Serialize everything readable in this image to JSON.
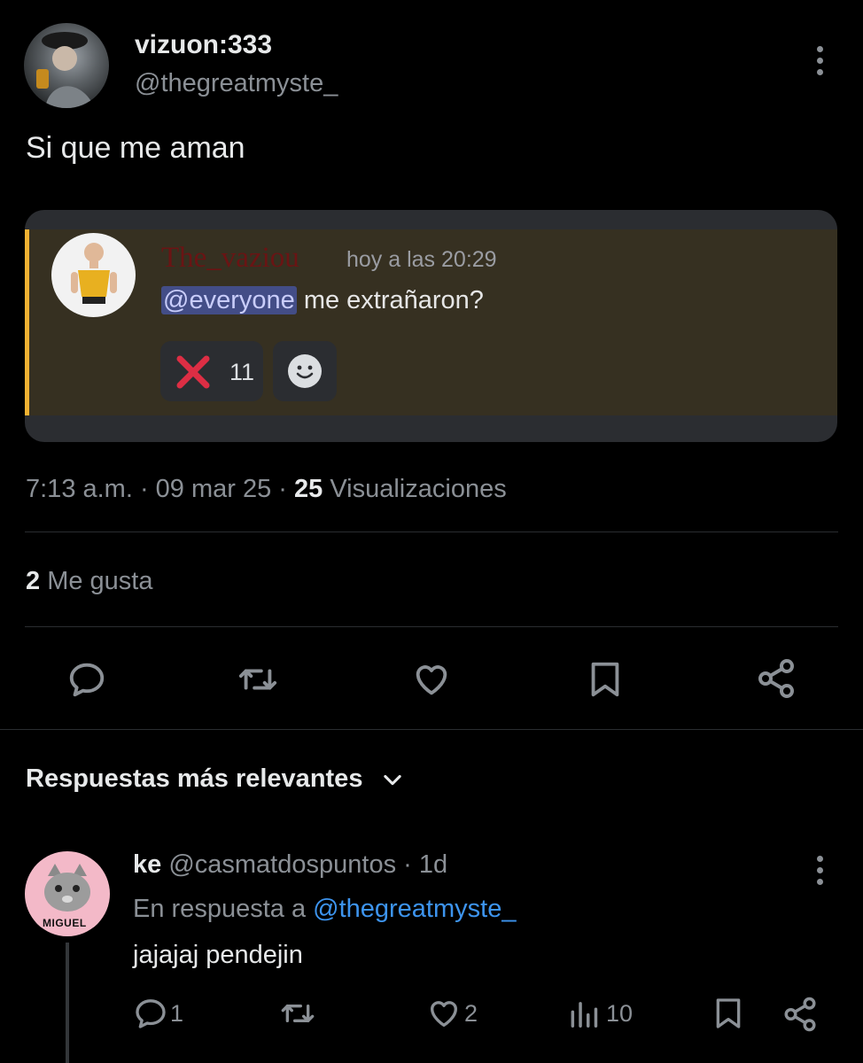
{
  "post": {
    "author_name": "vizuon:333",
    "author_handle": "@thegreatmyste_",
    "text": "Si que me aman",
    "timestamp": "7:13 a.m. · 09 mar 25 · ",
    "views_count": "25",
    "views_label": "Visualizaciones",
    "likes_count": "2",
    "likes_label": "Me gusta"
  },
  "embed": {
    "username": "The_vaziou",
    "time": "hoy a las 20:29",
    "mention": "@everyone",
    "message": "me extrañaron?",
    "reaction_count": "11",
    "username_color": "#6a1414",
    "accent_color": "#f0b232"
  },
  "replies_header": {
    "label": "Respuestas más relevantes"
  },
  "reply": {
    "author_name": "ke",
    "author_handle": "@casmatdospuntos",
    "age": "· 1d",
    "in_reply_prefix": "En respuesta a",
    "in_reply_handle": "@thegreatmyste_",
    "text": "jajajaj pendejin",
    "avatar_label": "MIGUEL",
    "reply_count": "1",
    "like_count": "2",
    "view_count": "10"
  },
  "icons": [
    "more-icon",
    "comment-icon",
    "retweet-icon",
    "heart-icon",
    "bookmark-icon",
    "share-icon",
    "chevron-down-icon",
    "views-icon",
    "smiley-icon",
    "red-x-icon"
  ]
}
